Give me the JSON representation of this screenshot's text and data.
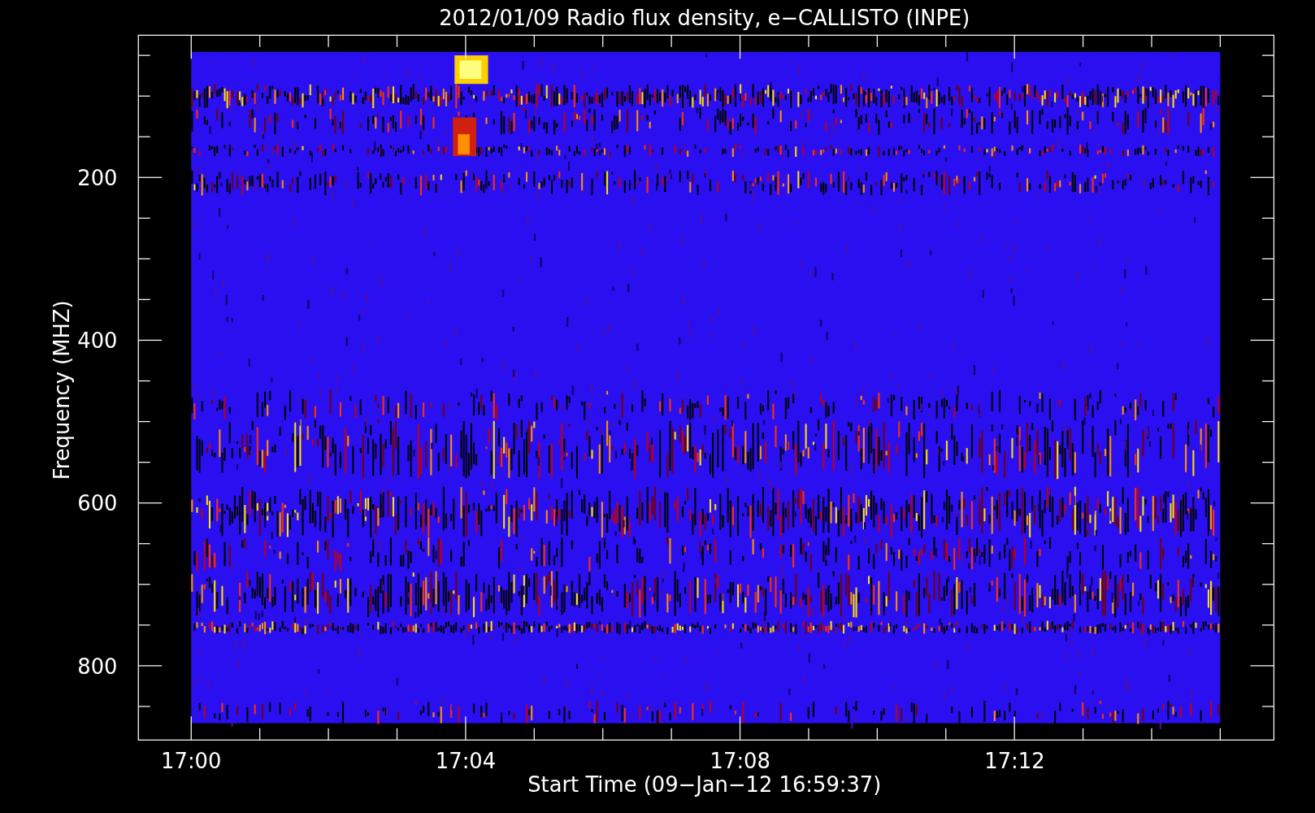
{
  "title": "2012/01/09  Radio flux density, e−CALLISTO (INPE)",
  "y_axis": {
    "label": "Frequency (MHZ)",
    "ticks": [
      "200",
      "400",
      "600",
      "800"
    ]
  },
  "x_axis": {
    "label": "Start Time (09−Jan−12 16:59:37)",
    "ticks": [
      "17:00",
      "17:04",
      "17:08",
      "17:12"
    ]
  }
}
